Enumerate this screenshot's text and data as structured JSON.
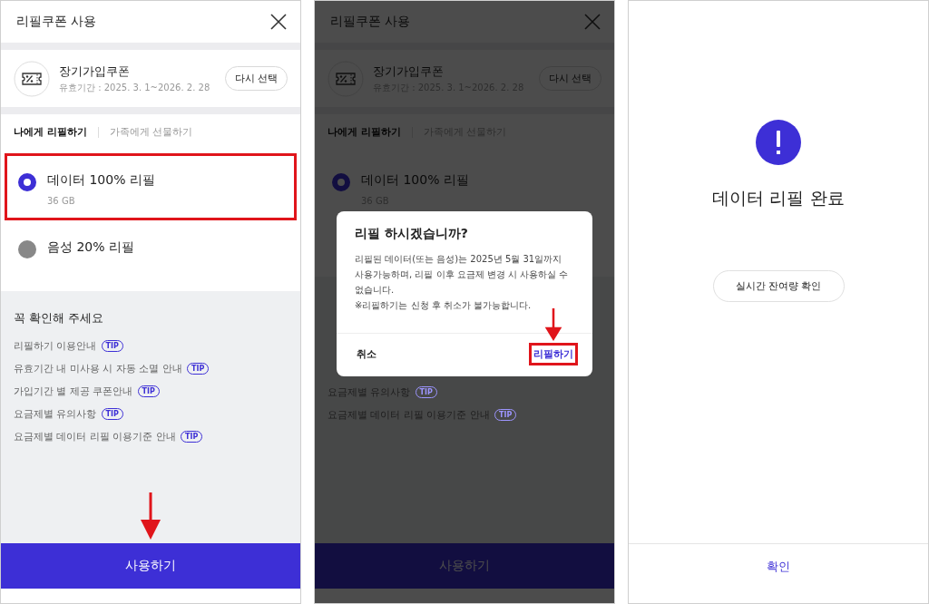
{
  "screens": [
    {
      "kind": "form",
      "header": {
        "title": "리필쿠폰 사용"
      },
      "coupon": {
        "name": "장기가입쿠폰",
        "validity": "유효기간 : 2025. 3. 1~2026. 2. 28",
        "button": "다시 선택"
      },
      "tabs": [
        {
          "label": "나에게 리필하기",
          "selected": true
        },
        {
          "label": "가족에게 선물하기",
          "selected": false
        }
      ],
      "options": [
        {
          "label": "데이터 100% 리필",
          "detail": "36 GB",
          "selected": true,
          "highlighted": true
        },
        {
          "label": "음성 20% 리필",
          "selected": false,
          "highlighted": false
        }
      ],
      "notice": {
        "heading": "꼭 확인해 주세요",
        "items": [
          {
            "text": "리필하기 이용안내",
            "badge": "TIP"
          },
          {
            "text": "유효기간 내 미사용 시 자동 소멸 안내",
            "badge": "TIP"
          },
          {
            "text": "가입기간 별 제공 쿠폰안내",
            "badge": "TIP"
          },
          {
            "text": "요금제별 유의사항",
            "badge": "TIP"
          },
          {
            "text": "요금제별 데이터 리필 이용기준 안내",
            "badge": "TIP"
          }
        ]
      },
      "primary_button": {
        "label": "사용하기",
        "arrow": true
      }
    },
    {
      "kind": "form",
      "dimmed": true,
      "header": {
        "title": "리필쿠폰 사용"
      },
      "coupon": {
        "name": "장기가입쿠폰",
        "validity": "유효기간 : 2025. 3. 1~2026. 2. 28",
        "button": "다시 선택"
      },
      "tabs": [
        {
          "label": "나에게 리필하기",
          "selected": true
        },
        {
          "label": "가족에게 선물하기",
          "selected": false
        }
      ],
      "options": [
        {
          "label": "데이터 100% 리필",
          "detail": "36 GB",
          "selected": true,
          "highlighted": false
        }
      ],
      "dialog": {
        "title": "리필 하시겠습니까?",
        "paragraphs": [
          "리필된 데이터(또는 음성)는 2025년 5월 31일까지 사용가능하며, 리필 이후 요금제 변경 시 사용하실 수 없습니다.",
          "※리필하기는 신청 후 취소가 불가능합니다."
        ],
        "cancel": "취소",
        "confirm": {
          "label": "리필하기",
          "highlighted": true,
          "arrow": true
        }
      },
      "notice": {
        "items": [
          {
            "text": "요금제별 유의사항",
            "badge": "TIP"
          },
          {
            "text": "요금제별 데이터 리필 이용기준 안내",
            "badge": "TIP"
          }
        ]
      },
      "primary_button": {
        "label": "사용하기"
      }
    },
    {
      "kind": "result",
      "title": "데이터 리필 완료",
      "link_button": "실시간 잔여량 확인",
      "bottom_button": "확인"
    }
  ]
}
